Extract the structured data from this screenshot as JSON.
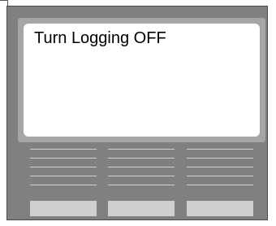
{
  "display": {
    "message": "Turn Logging OFF"
  },
  "softkeys": [
    {
      "label": ""
    },
    {
      "label": ""
    },
    {
      "label": ""
    }
  ],
  "colors": {
    "device_body": "#808080",
    "screen_bezel": "#a6a6a6",
    "screen": "#ffffff",
    "softkey": "#cfcfcf",
    "menu_line": "#d0d0d0"
  }
}
